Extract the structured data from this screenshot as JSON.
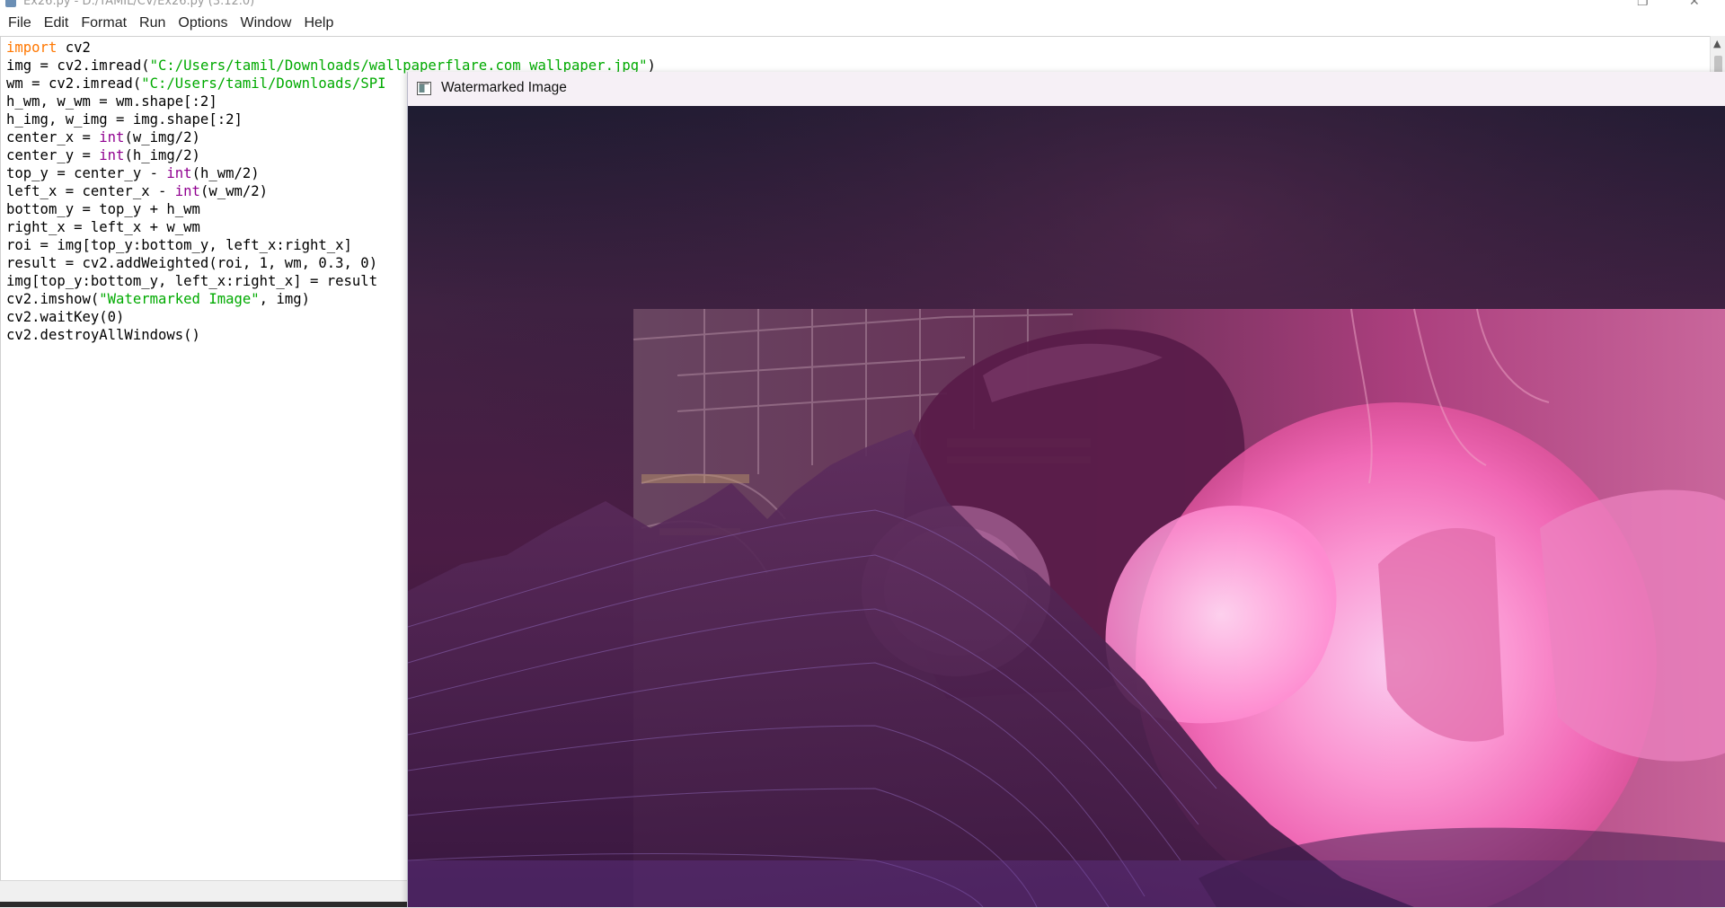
{
  "editor": {
    "title": "Ex26.py - D:/TAMIL/CV/Ex26.py (3.12.0)",
    "menu": [
      "File",
      "Edit",
      "Format",
      "Run",
      "Options",
      "Window",
      "Help"
    ],
    "code_lines": [
      "import cv2",
      "img = cv2.imread(\"C:/Users/tamil/Downloads/wallpaperflare.com wallpaper.jpg\")",
      "wm = cv2.imread(\"C:/Users/tamil/Downloads/SPI",
      "h_wm, w_wm = wm.shape[:2]",
      "h_img, w_img = img.shape[:2]",
      "center_x = int(w_img/2)",
      "center_y = int(h_img/2)",
      "top_y = center_y - int(h_wm/2)",
      "left_x = center_x - int(w_wm/2)",
      "bottom_y = top_y + h_wm",
      "right_x = left_x + w_wm",
      "roi = img[top_y:bottom_y, left_x:right_x]",
      "result = cv2.addWeighted(roi, 1, wm, 0.3, 0)",
      "img[top_y:bottom_y, left_x:right_x] = result",
      "cv2.imshow(\"Watermarked Image\", img)",
      "cv2.waitKey(0)",
      "cv2.destroyAllWindows()"
    ],
    "syntax_colors": {
      "keyword": "#ff7700",
      "builtin": "#900090",
      "string": "#00aa00"
    }
  },
  "image_window": {
    "title": "Watermarked Image"
  }
}
